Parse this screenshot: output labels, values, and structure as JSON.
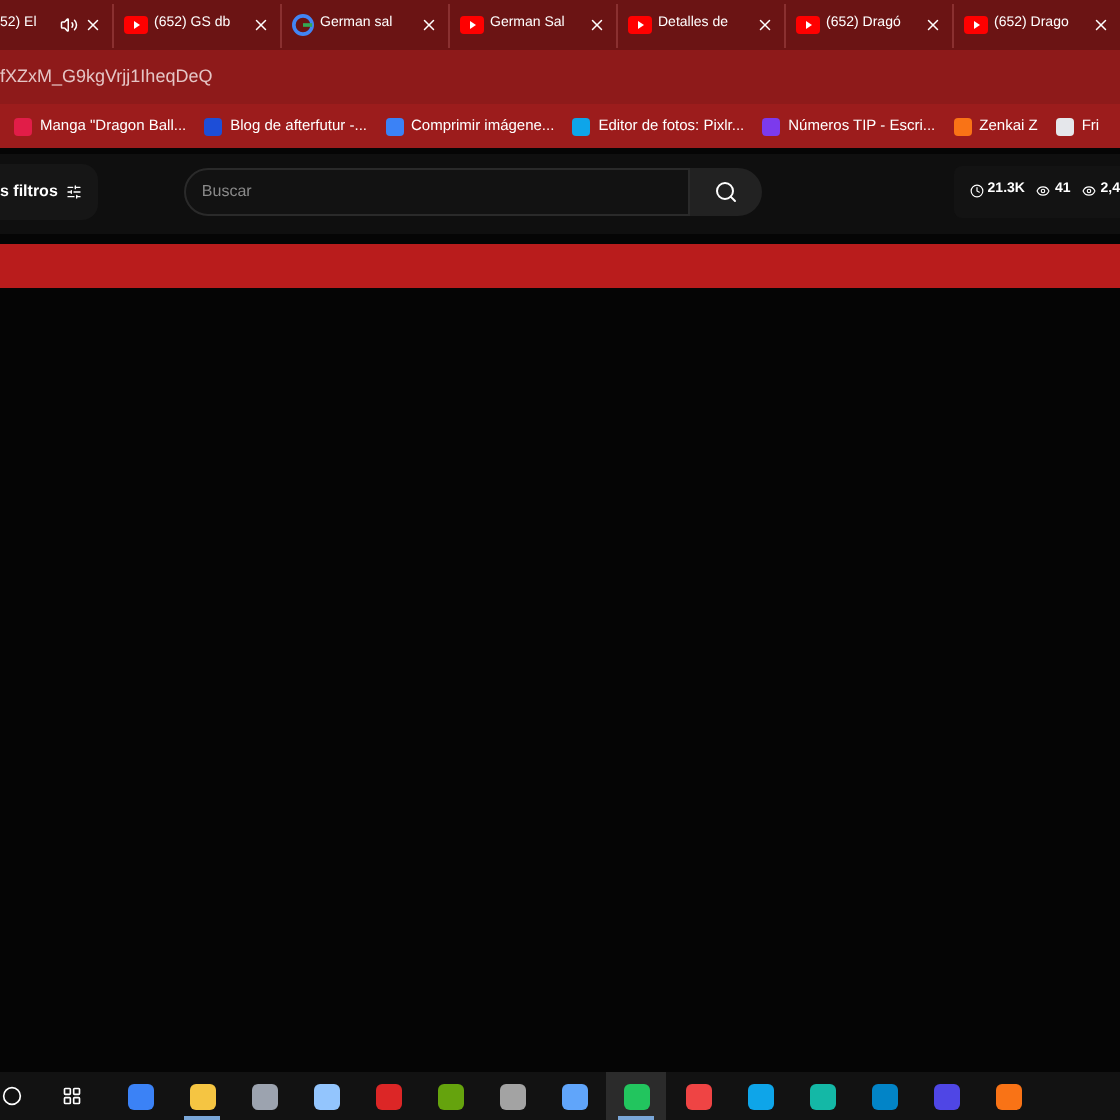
{
  "tabs": [
    {
      "title": "52) El",
      "kind": "audio",
      "selected": false
    },
    {
      "title": "(652) GS db",
      "kind": "youtube",
      "selected": false
    },
    {
      "title": "German sal",
      "kind": "google",
      "selected": false
    },
    {
      "title": "German Sal",
      "kind": "youtube",
      "selected": false
    },
    {
      "title": "Detalles de",
      "kind": "youtube",
      "selected": false
    },
    {
      "title": "(652) Dragó",
      "kind": "youtube",
      "selected": false
    },
    {
      "title": "(652) Drago",
      "kind": "youtube",
      "selected": false
    }
  ],
  "address": "fXZxM_G9kgVrjj1IheqDeQ",
  "bookmarks": [
    {
      "title": "Manga \"Dragon Ball...",
      "color": "#e11d48"
    },
    {
      "title": "Blog de afterfutur -...",
      "color": "#1d4ed8"
    },
    {
      "title": "Comprimir imágene...",
      "color": "#3b82f6"
    },
    {
      "title": "Editor de fotos: Pixlr...",
      "color": "#0ea5e9"
    },
    {
      "title": "Números TIP - Escri...",
      "color": "#7c3aed"
    },
    {
      "title": "Zenkai Z",
      "color": "#f97316"
    },
    {
      "title": "Fri",
      "color": "#e5e7eb"
    }
  ],
  "header": {
    "filters": "s filtros",
    "search": {
      "placeholder": "Buscar"
    },
    "stats": [
      {
        "kind": "clock",
        "text": "21.3K"
      },
      {
        "kind": "eye",
        "text": "41"
      },
      {
        "kind": "eye",
        "text": "2,4"
      }
    ]
  },
  "taskbar": [
    {
      "color": "#3b82f6",
      "selected": false
    },
    {
      "color": "#f5c542",
      "selected": false,
      "running": true
    },
    {
      "color": "#9ca3af",
      "selected": false
    },
    {
      "color": "#93c5fd",
      "selected": false
    },
    {
      "color": "#dc2626",
      "selected": false
    },
    {
      "color": "#65a30d",
      "selected": false
    },
    {
      "color": "#a3a3a3",
      "selected": false
    },
    {
      "color": "#60a5fa",
      "selected": false
    },
    {
      "color": "#22c55e",
      "selected": true,
      "running": true
    },
    {
      "color": "#ef4444",
      "selected": false
    },
    {
      "color": "#0ea5e9",
      "selected": false
    },
    {
      "color": "#14b8a6",
      "selected": false
    },
    {
      "color": "#0284c7",
      "selected": false
    },
    {
      "color": "#4f46e5",
      "selected": false
    },
    {
      "color": "#f97316",
      "selected": false
    }
  ]
}
